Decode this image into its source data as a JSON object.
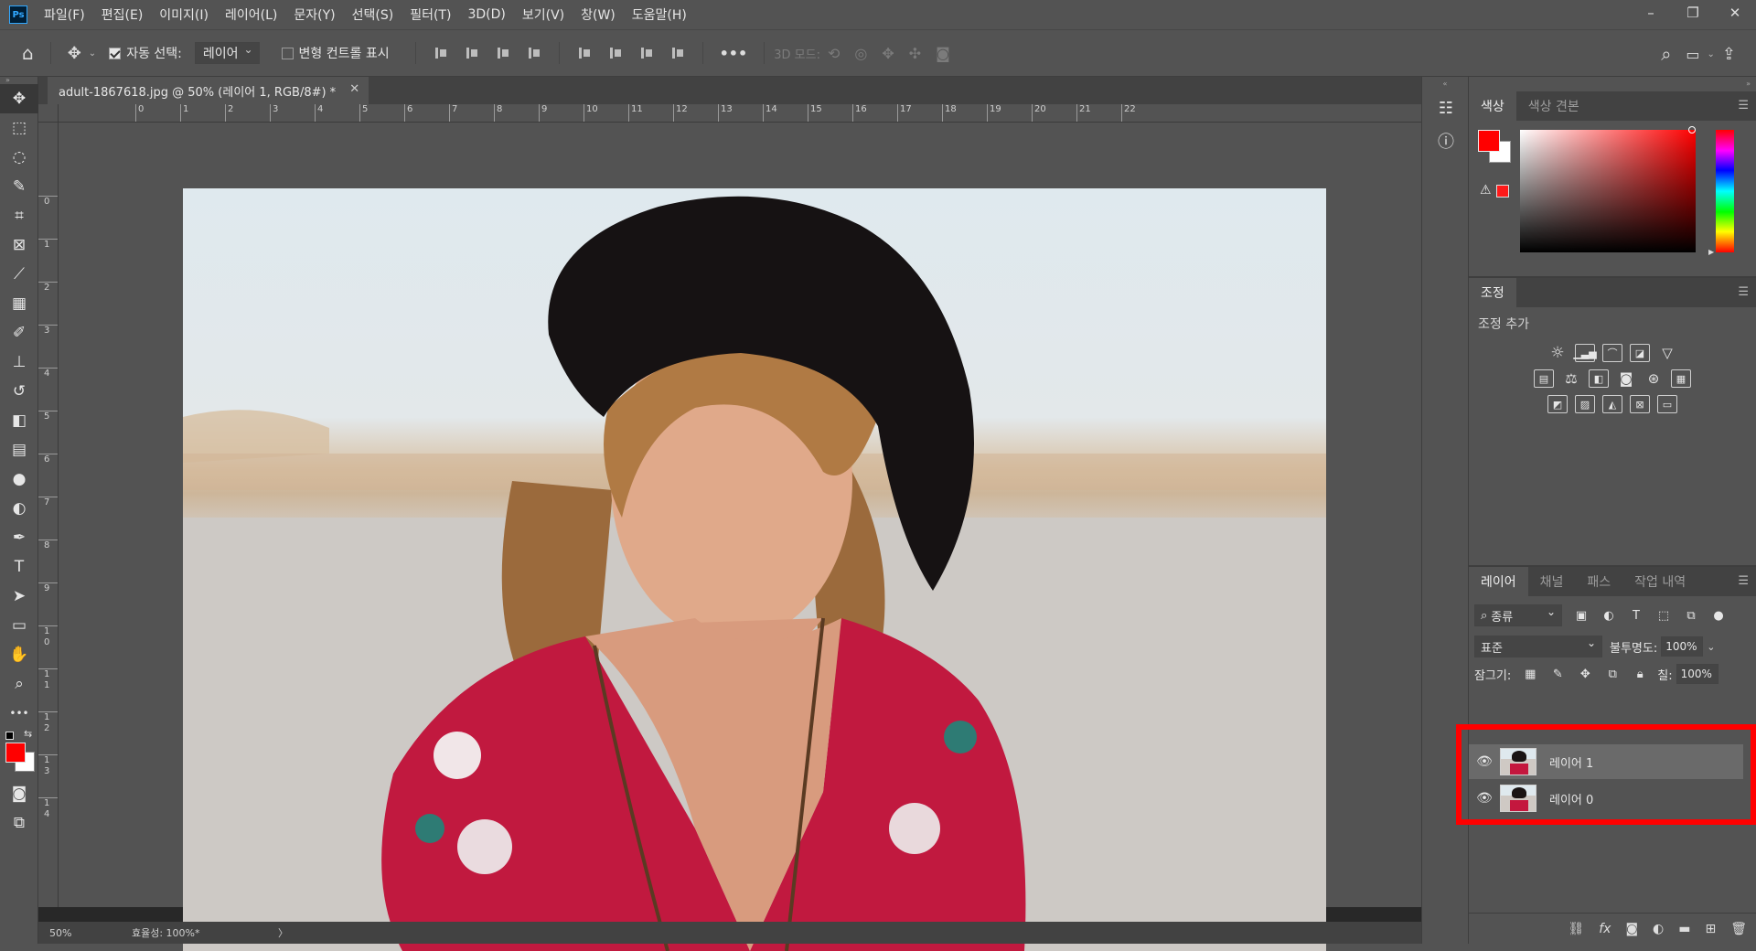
{
  "app": {
    "logo": "Ps"
  },
  "menu": [
    "파일(F)",
    "편집(E)",
    "이미지(I)",
    "레이어(L)",
    "문자(Y)",
    "선택(S)",
    "필터(T)",
    "3D(D)",
    "보기(V)",
    "창(W)",
    "도움말(H)"
  ],
  "window_controls": {
    "minimize": "–",
    "restore": "❐",
    "close": "✕"
  },
  "options": {
    "home_icon": "⌂",
    "move_icon": "✥",
    "auto_select_label": "자동 선택:",
    "auto_select_checked": true,
    "auto_select_value": "레이어",
    "transform_label": "변형 컨트롤 표시",
    "transform_checked": false,
    "more": "•••",
    "mode_3d_label": "3D 모드:",
    "search_icon": "⌕",
    "share_icon": "⇪"
  },
  "tools": [
    {
      "name": "move-tool",
      "icon": "✥"
    },
    {
      "name": "marquee-tool",
      "icon": "⬚"
    },
    {
      "name": "lasso-tool",
      "icon": "◌"
    },
    {
      "name": "quick-select-tool",
      "icon": "✎"
    },
    {
      "name": "crop-tool",
      "icon": "⌗"
    },
    {
      "name": "frame-tool",
      "icon": "⊠"
    },
    {
      "name": "eyedropper-tool",
      "icon": "⟋"
    },
    {
      "name": "healing-tool",
      "icon": "▦"
    },
    {
      "name": "brush-tool",
      "icon": "✐"
    },
    {
      "name": "stamp-tool",
      "icon": "⊥"
    },
    {
      "name": "history-brush-tool",
      "icon": "↺"
    },
    {
      "name": "eraser-tool",
      "icon": "◧"
    },
    {
      "name": "gradient-tool",
      "icon": "▤"
    },
    {
      "name": "blur-tool",
      "icon": "●"
    },
    {
      "name": "dodge-tool",
      "icon": "◐"
    },
    {
      "name": "pen-tool",
      "icon": "✒"
    },
    {
      "name": "type-tool",
      "icon": "T"
    },
    {
      "name": "path-select-tool",
      "icon": "➤"
    },
    {
      "name": "shape-tool",
      "icon": "▭"
    },
    {
      "name": "hand-tool",
      "icon": "✋"
    },
    {
      "name": "zoom-tool",
      "icon": "⌕"
    },
    {
      "name": "more-tools",
      "icon": "•••"
    }
  ],
  "document": {
    "tab_title": "adult-1867618.jpg @ 50% (레이어 1, RGB/8#) *",
    "close": "✕",
    "ruler_h": [
      "0",
      "1",
      "2",
      "3",
      "4",
      "5",
      "6",
      "7",
      "8",
      "9",
      "10",
      "11",
      "12",
      "13",
      "14",
      "15",
      "16",
      "17",
      "18",
      "19",
      "20",
      "21",
      "22"
    ],
    "ruler_v": [
      "0",
      "1",
      "2",
      "3",
      "4",
      "5",
      "6",
      "7",
      "8",
      "9",
      "1\n0",
      "1\n1",
      "1\n2",
      "1\n3",
      "1\n4"
    ],
    "zoom": "50%",
    "status": "효율성: 100%*",
    "status_arrow": "〉"
  },
  "panels": {
    "color_tabs": [
      "색상",
      "색상 견본"
    ],
    "foreground_color": "#ff0000",
    "background_color": "#ffffff",
    "adjust_tab": "조정",
    "adjust_add_label": "조정 추가",
    "layers_tabs": [
      "레이어",
      "채널",
      "패스",
      "작업 내역"
    ],
    "filter_kind": "종류",
    "blend_mode": "표준",
    "opacity_label": "불투명도:",
    "opacity_value": "100%",
    "lock_label": "잠그기:",
    "fill_label": "칠:",
    "fill_value": "100%",
    "layers": [
      {
        "name": "레이어 1",
        "selected": true
      },
      {
        "name": "레이어 0",
        "selected": false
      }
    ]
  }
}
